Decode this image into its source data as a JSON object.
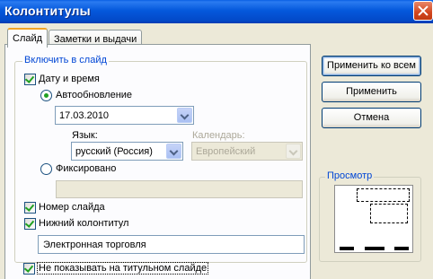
{
  "window": {
    "title": "Колонтитулы"
  },
  "tabs": [
    {
      "label": "Слайд",
      "active": true
    },
    {
      "label": "Заметки и выдачи",
      "active": false
    }
  ],
  "slide_tab": {
    "group_title": "Включить в слайд",
    "date_time": {
      "label": "Дату и время",
      "checked": true
    },
    "autoupdate": {
      "label": "Автообновление",
      "selected": true,
      "date_value": "17.03.2010"
    },
    "language": {
      "label": "Язык:",
      "value": "русский (Россия)"
    },
    "calendar": {
      "label": "Календарь:",
      "value": "Европейский",
      "enabled": false
    },
    "fixed": {
      "label": "Фиксировано",
      "selected": false,
      "value": ""
    },
    "slide_number": {
      "label": "Номер слайда",
      "checked": true
    },
    "footer": {
      "label": "Нижний колонтитул",
      "checked": true,
      "value": "Электронная торговля"
    },
    "hide_on_title": {
      "label": "Не показывать на титульном слайде",
      "checked": true
    }
  },
  "buttons": {
    "apply_all": "Применить ко всем",
    "apply": "Применить",
    "cancel": "Отмена"
  },
  "preview": {
    "title": "Просмотр"
  },
  "colors": {
    "titlebar": "#0458DC",
    "dialog_bg": "#ECE9D8",
    "group_title": "#0046D5",
    "tab_highlight": "#F0A427",
    "checkmark": "#21A121"
  }
}
